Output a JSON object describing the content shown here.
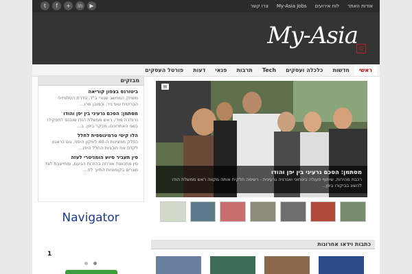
{
  "topbar": {
    "social": [
      "twitter-icon",
      "facebook-icon",
      "plus-icon",
      "linkedin-icon",
      "youtube-icon"
    ],
    "social_glyphs": [
      "t",
      "f",
      "+",
      "in",
      "▶"
    ],
    "links": [
      "אודות האתר",
      "לוח אירועים",
      "My-Asia Jobs",
      "צרו קשר"
    ]
  },
  "header": {
    "logo": "My-Asia",
    "stamp": "亞"
  },
  "nav": {
    "items": [
      "ראשי",
      "חדשות",
      "כלכלה ועסקים",
      "Tech",
      "תרבות",
      "פנאי",
      "דעות",
      "פורטל העסקים"
    ]
  },
  "sidebar": {
    "title": "מבזקים",
    "items": [
      {
        "title": "ביטורנס בצפון קוריאה",
        "desc": "משחק המחשב שגורי ב\"ד, סדרת הטלוויזיה הבריטית טופ גיר, וכמובן מרג..."
      },
      {
        "title": "מסתמן: הסכם גרעיני בין יפן והודו",
        "desc": "נרנדרה מודי, ראש ממשלת הודו שנכנס לתפקידו בשני האחרונים, מבקר ביפן, ב..."
      },
      {
        "title": "הלו קיטי טרמינוספית לחלל",
        "desc": "כחלק מהצינות ה-40 לוויקון היפני, נום כראגון לקדם את תוכניות החלל היפנ..."
      },
      {
        "title": "סין תעביר סיוע הומניטרי לעזה",
        "desc": "סין מתכוונת אורחה בהזרות הגיעם, ומתייצבת לצד מצרים בקומוניות התיוך לפ..."
      }
    ]
  },
  "navigator": {
    "text": "Navigator"
  },
  "poll": {
    "number": "1"
  },
  "feature": {
    "icon": "▤",
    "title": "מסתמן: הסכם גרעיני בין יפן והודו",
    "desc": "רכבת מהירות, שיתוף פעולה ביטחוני ואנרגיה גרעינית - רשימה חלקית אותה מקווה ראש ממשלת הודו להשיג בביקורו ביפן..."
  },
  "latest": {
    "title": "כתבות וידאו אחרונות"
  },
  "colors": {
    "accent": "#cc0000",
    "header_bg": "#343434",
    "topbar_bg": "#2b2b2b",
    "navigator": "#1a3a9a",
    "button": "#3b9d3b"
  }
}
